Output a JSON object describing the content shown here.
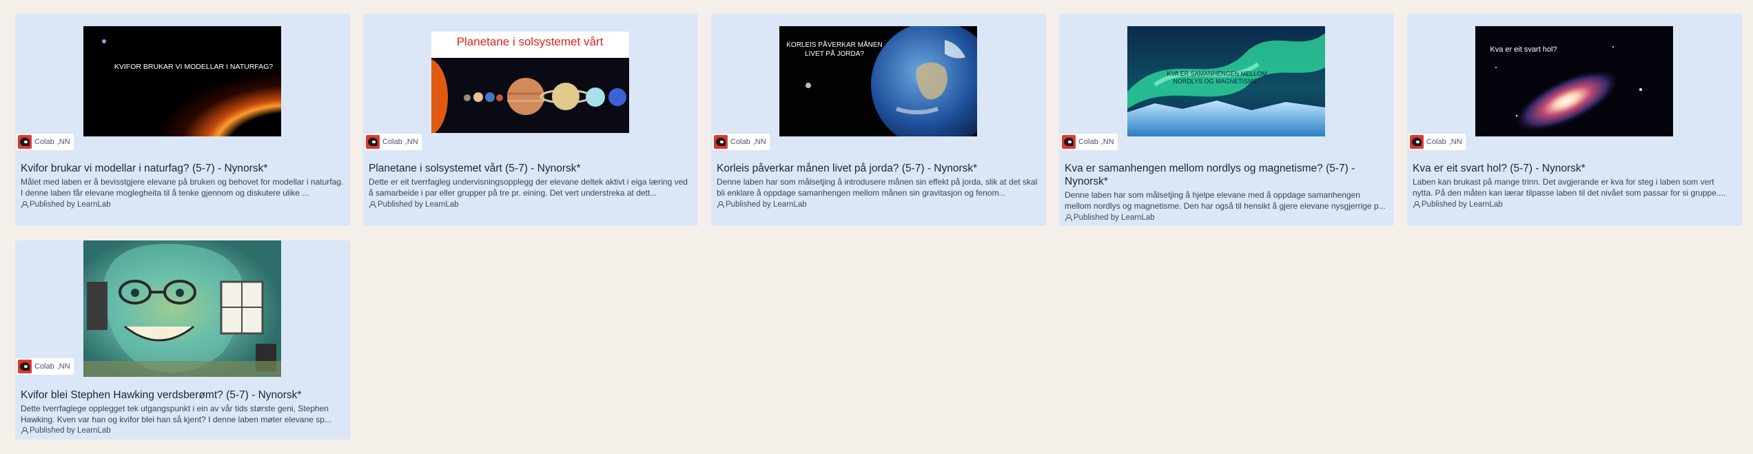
{
  "cards": [
    {
      "thumb_text": "KVIFOR BRUKAR VI MODELLAR I NATURFAG?",
      "chip_brand": "Colab",
      "chip_lang": ",NN",
      "title": "Kvifor brukar vi modellar i naturfag? (5-7) - Nynorsk*",
      "description": "Målet med laben er å bevisstgjere elevane på bruken og behovet for modellar i naturfag. I denne laben får elevane moglegheita til å tenke gjennom og diskutere ulike ...",
      "publisher": "Published by LearnLab"
    },
    {
      "thumb_text": "Planetane i solsystemet vårt",
      "chip_brand": "Colab",
      "chip_lang": ",NN",
      "title": "Planetane i solsystemet vårt (5-7) - Nynorsk*",
      "description": "Dette er eit tverrfagleg undervisningsopplegg der elevane deltek aktivt i eiga læring ved å samarbeide i par eller grupper på tre pr. eining. Det vert understreka at dett...",
      "publisher": "Published by LearnLab"
    },
    {
      "thumb_text_1": "KORLEIS PÅVERKAR MÅNEN",
      "thumb_text_2": "LIVET PÅ JORDA?",
      "chip_brand": "Colab",
      "chip_lang": ",NN",
      "title": "Korleis påverkar månen livet på jorda? (5-7) - Nynorsk*",
      "description": "Denne laben har som målsetjing å introdusere månen sin effekt på jorda, slik at det skal bli enklare å oppdage samanhengen mellom månen sin gravitasjon og fenom...",
      "publisher": "Published by LearnLab"
    },
    {
      "thumb_text_1": "KVA ER SAMANHENGEN MELLOM",
      "thumb_text_2": "NORDLYS OG MAGNETISME?",
      "chip_brand": "Colab",
      "chip_lang": ",NN",
      "title": "Kva er samanhengen mellom nordlys og magnetisme? (5-7) - Nynorsk*",
      "description": "Denne laben har som målsetjing å hjelpe elevane med å oppdage samanhengen mellom nordlys og magnetisme. Den har også til hensikt å gjere elevane nysgjerrige p...",
      "publisher": "Published by LearnLab"
    },
    {
      "thumb_text": "Kva er eit svart hol?",
      "chip_brand": "Colab",
      "chip_lang": ",NN",
      "title": "Kva er eit svart hol? (5-7) - Nynorsk*",
      "description": "Laben kan brukast på mange trinn. Det avgjerande er kva for steg i laben som vert nytta. På den måten kan lærar tilpasse laben til det nivået som passar for si gruppe....",
      "publisher": "Published by LearnLab"
    },
    {
      "chip_brand": "Colab",
      "chip_lang": ",NN",
      "title": "Kvifor blei Stephen Hawking verdsberømt? (5-7) - Nynorsk*",
      "description": "Dette tverrfaglege opplegget tek utgangspunkt i ein av vår tids største geni, Stephen Hawking. Kven var han og kvifor blei han så kjent? I denne laben møter elevane sp...",
      "publisher": "Published by LearnLab"
    }
  ],
  "colors": {
    "page_bg": "#f4efe9",
    "card_bg": "#dbe7f6",
    "chip_logo": "#e2392d"
  }
}
